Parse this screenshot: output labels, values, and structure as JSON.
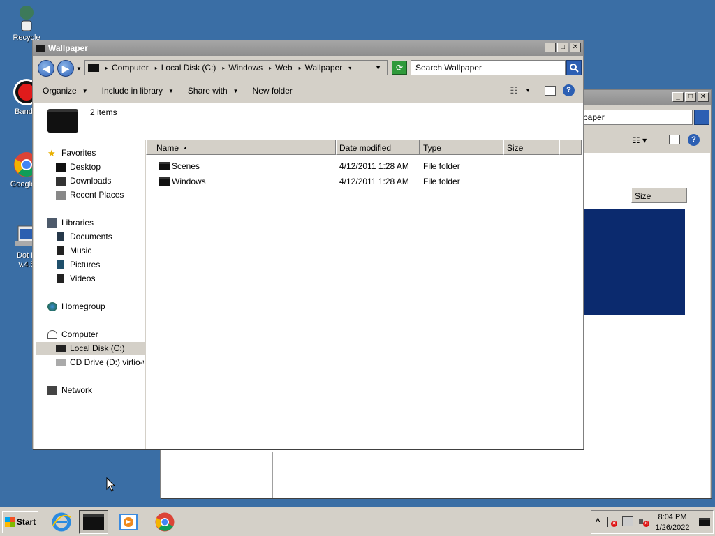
{
  "desktop": {
    "icons": [
      {
        "label": "Recycle"
      },
      {
        "label": "Bandic"
      },
      {
        "label": "Google C"
      },
      {
        "label": "Dot N",
        "label2": "v.4.5"
      }
    ]
  },
  "back_window": {
    "search_text": "paper",
    "size_header": "Size"
  },
  "window": {
    "title": "Wallpaper",
    "breadcrumb": [
      "Computer",
      "Local Disk (C:)",
      "Windows",
      "Web",
      "Wallpaper"
    ],
    "search_placeholder": "Search Wallpaper",
    "toolbar": {
      "organize": "Organize",
      "include_in_library": "Include in library",
      "share_with": "Share with",
      "new_folder": "New folder"
    },
    "item_count": "2 items",
    "nav": {
      "favorites": "Favorites",
      "desktop": "Desktop",
      "downloads": "Downloads",
      "recent_places": "Recent Places",
      "libraries": "Libraries",
      "documents": "Documents",
      "music": "Music",
      "pictures": "Pictures",
      "videos": "Videos",
      "homegroup": "Homegroup",
      "computer": "Computer",
      "local_disk": "Local Disk (C:)",
      "cd_drive": "CD Drive (D:) virtio-wi",
      "network": "Network"
    },
    "columns": {
      "name": "Name",
      "date_modified": "Date modified",
      "type": "Type",
      "size": "Size"
    },
    "files": [
      {
        "name": "Scenes",
        "date": "4/12/2011 1:28 AM",
        "type": "File folder"
      },
      {
        "name": "Windows",
        "date": "4/12/2011 1:28 AM",
        "type": "File folder"
      }
    ]
  },
  "taskbar": {
    "start_label": "Start",
    "time": "8:04 PM",
    "date": "1/26/2022"
  }
}
